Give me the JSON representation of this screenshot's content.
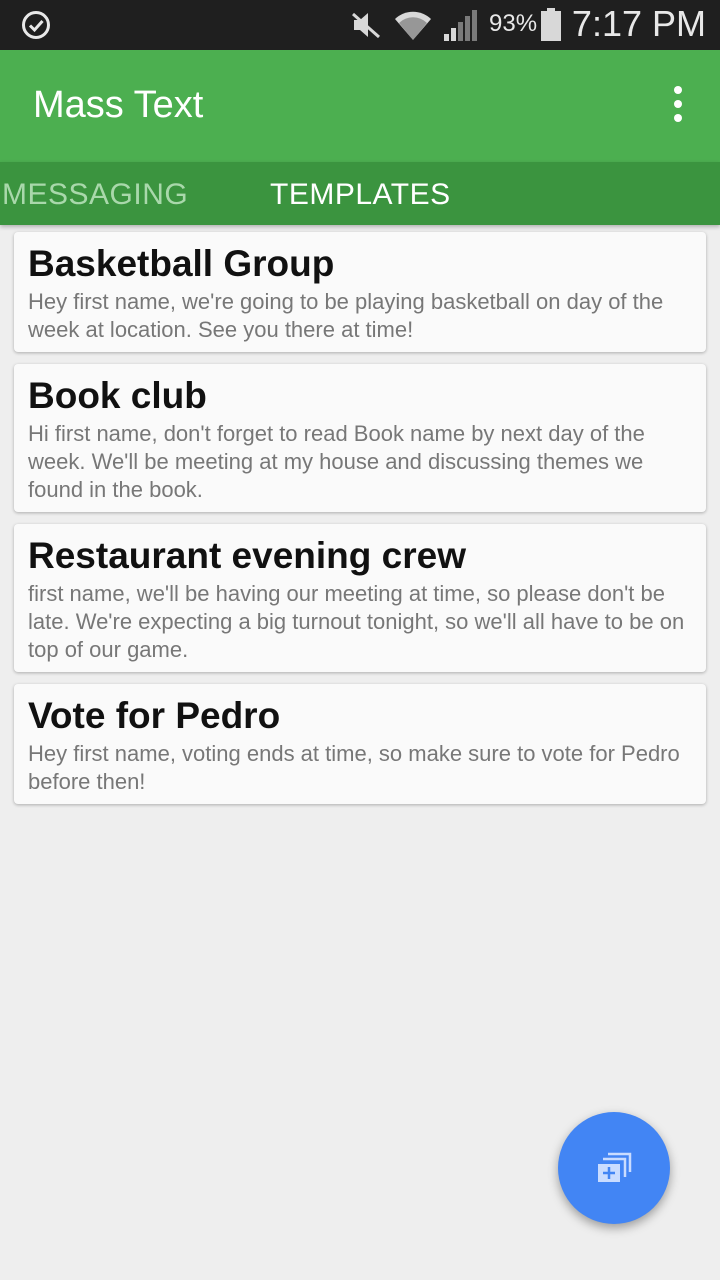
{
  "status_bar": {
    "battery_percent": "93%",
    "time": "7:17 PM",
    "icons": [
      "check-circle-icon",
      "mute-icon",
      "wifi-icon",
      "signal-icon",
      "battery-icon"
    ]
  },
  "app_bar": {
    "title": "Mass Text",
    "menu_icon": "more-vert-icon"
  },
  "tabs": [
    {
      "label": "MESSAGING",
      "selected": false
    },
    {
      "label": "TEMPLATES",
      "selected": true
    }
  ],
  "templates": [
    {
      "title": "Basketball Group",
      "body": "Hey first name, we're going to be playing basketball on day of the week at location. See you there at time!"
    },
    {
      "title": "Book club",
      "body": "Hi first name, don't forget to read Book name by next day of the week. We'll be meeting at my house and discussing themes we found in the book."
    },
    {
      "title": "Restaurant evening crew",
      "body": "first name, we'll be having our meeting at time, so please don't be late. We're expecting a big turnout tonight, so we'll all have to be on top of our game."
    },
    {
      "title": "Vote for Pedro",
      "body": "Hey first name, voting ends at time, so make sure to vote for Pedro before then!"
    }
  ],
  "fab": {
    "icon": "add-template-icon"
  },
  "colors": {
    "primary": "#4caf50",
    "primary_dark": "#3b943f",
    "fab": "#4285f4",
    "background": "#eeeeee"
  }
}
